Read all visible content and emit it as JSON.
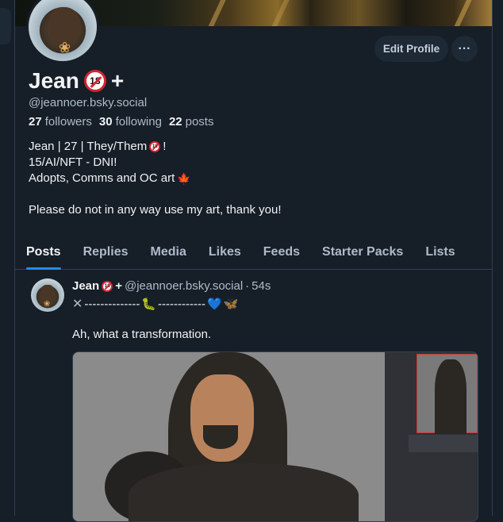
{
  "profile": {
    "display_name": "Jean",
    "name_suffix": "+",
    "handle": "@jeannoer.bsky.social",
    "edit_label": "Edit Profile",
    "more_label": "···",
    "stats": {
      "followers_count": "27",
      "followers_label": "followers",
      "following_count": "30",
      "following_label": "following",
      "posts_count": "22",
      "posts_label": "posts"
    },
    "bio": {
      "line1": "Jean | 27 | They/Them",
      "line1_end": "!",
      "line2": "15/AI/NFT - DNI!",
      "line3": "Adopts, Comms and OC art",
      "line4": "Please do not in any way use my art, thank you!"
    }
  },
  "tabs": [
    {
      "label": "Posts",
      "active": true
    },
    {
      "label": "Replies"
    },
    {
      "label": "Media"
    },
    {
      "label": "Likes"
    },
    {
      "label": "Feeds"
    },
    {
      "label": "Starter Packs"
    },
    {
      "label": "Lists"
    }
  ],
  "post": {
    "author": "Jean",
    "author_suffix": "+",
    "handle": "@jeannoer.bsky.social",
    "separator": "·",
    "time": "54s",
    "deco_left": "--------------",
    "deco_right": "------------",
    "text": "Ah, what a transformation."
  },
  "icons": {
    "badge_18": "18",
    "flower": "❀",
    "leaf": "🍁",
    "caterpillar": "🐛",
    "heart": "💙",
    "butterfly": "🦋",
    "cross": "✕"
  },
  "colors": {
    "background": "#161e27",
    "accent": "#208bfe",
    "muted_text": "#aebbc9"
  }
}
